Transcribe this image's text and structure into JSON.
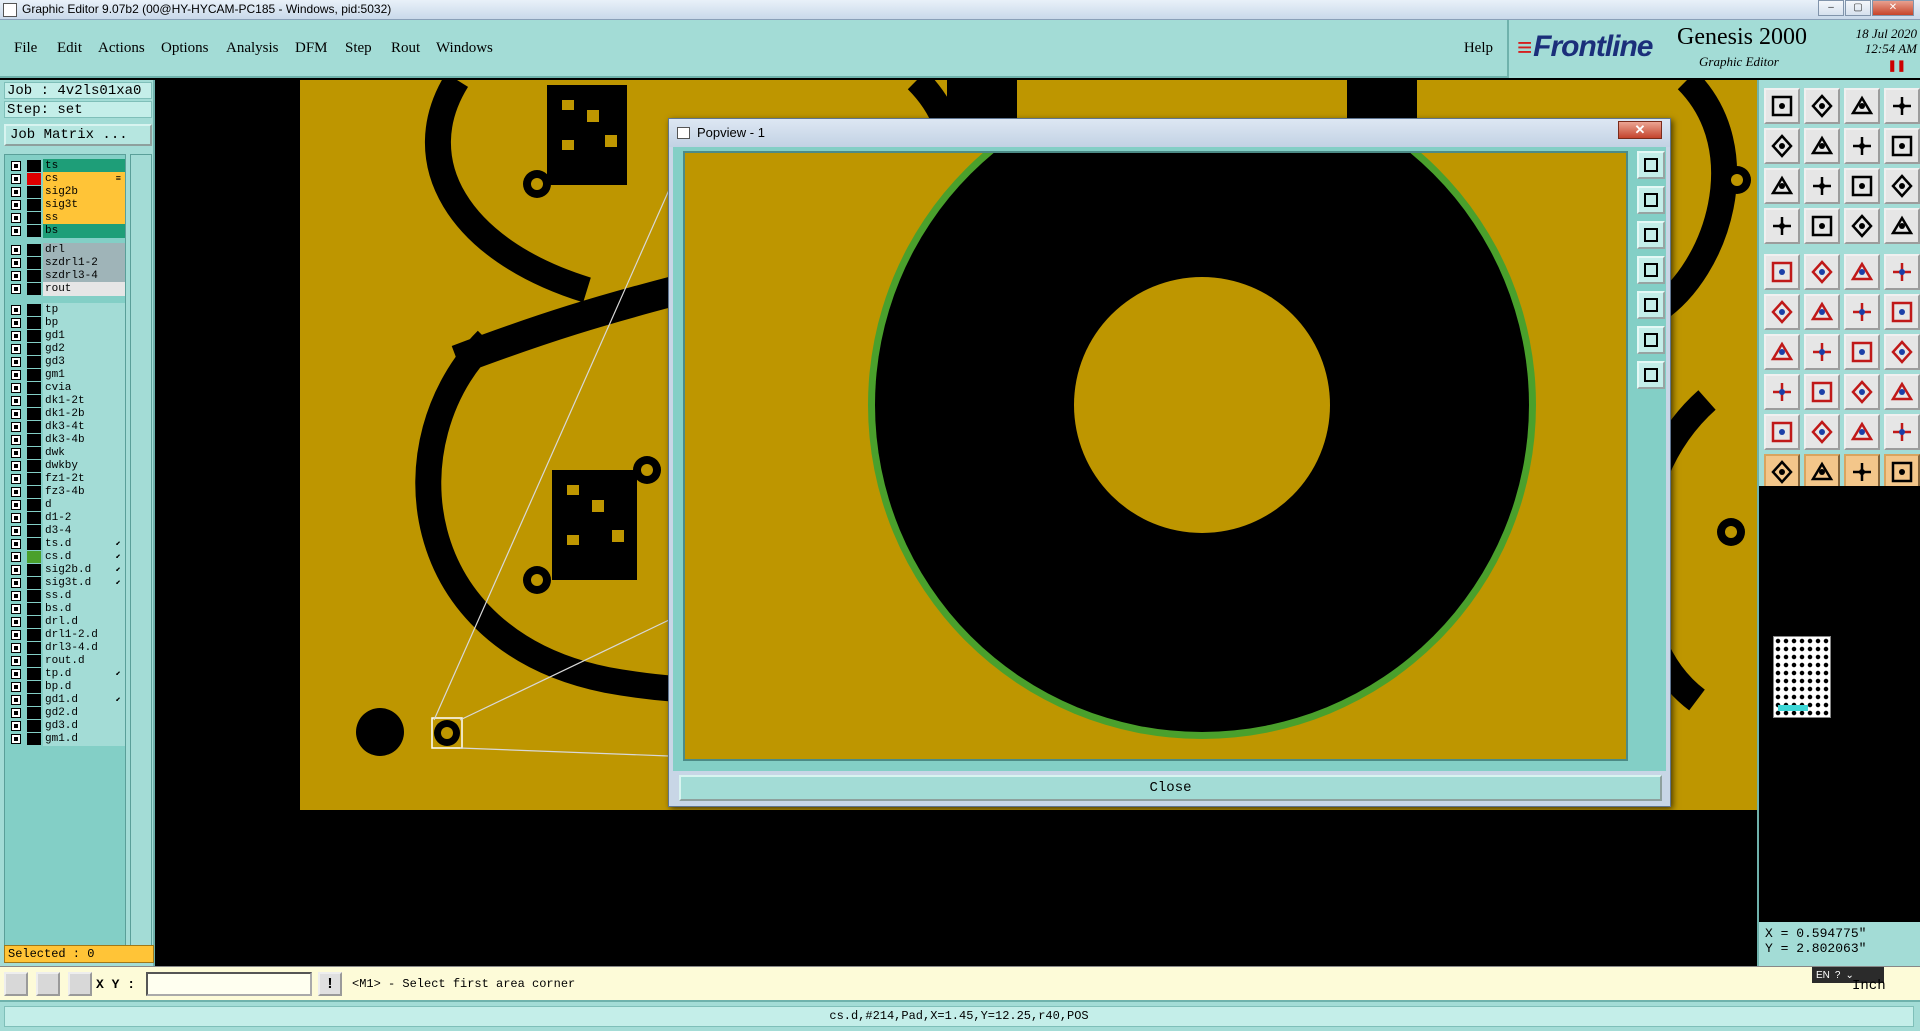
{
  "window": {
    "title": "Graphic Editor 9.07b2 (00@HY-HYCAM-PC185 - Windows, pid:5032)",
    "min": "–",
    "max": "▢",
    "close": "✕"
  },
  "menu": {
    "items": [
      "File",
      "Edit",
      "Actions",
      "Options",
      "Analysis",
      "DFM",
      "Step",
      "Rout",
      "Windows"
    ],
    "help": "Help"
  },
  "brand": {
    "logo": "Frontline",
    "product": "Genesis 2000",
    "subtitle": "Graphic Editor",
    "date": "18 Jul 2020",
    "time": "12:54 AM",
    "pause": "❚❚"
  },
  "left": {
    "job": "Job : 4v2ls01xa0",
    "step": "Step: set",
    "job_matrix": "Job Matrix ...",
    "selected": "Selected : 0"
  },
  "layers": [
    {
      "name": "ts",
      "bg": "#1e9e78",
      "sw": "#000000",
      "mk": ""
    },
    {
      "name": "cs",
      "bg": "#ffc437",
      "sw": "#e00000",
      "mk": "≡"
    },
    {
      "name": "sig2b",
      "bg": "#ffc437",
      "sw": "#000000",
      "mk": ""
    },
    {
      "name": "sig3t",
      "bg": "#ffc437",
      "sw": "#000000",
      "mk": ""
    },
    {
      "name": "ss",
      "bg": "#ffc437",
      "sw": "#000000",
      "mk": ""
    },
    {
      "name": "bs",
      "bg": "#1e9e78",
      "sw": "#000000",
      "mk": ""
    },
    {
      "name": "drl",
      "bg": "#9fb4b8",
      "sw": "#000000",
      "mk": ""
    },
    {
      "name": "szdrl1-2",
      "bg": "#9fb4b8",
      "sw": "#000000",
      "mk": ""
    },
    {
      "name": "szdrl3-4",
      "bg": "#9fb4b8",
      "sw": "#000000",
      "mk": ""
    },
    {
      "name": "rout",
      "bg": "#e6e6e6",
      "sw": "#000000",
      "mk": ""
    },
    {
      "name": "tp",
      "bg": "#a3dcd6",
      "sw": "#000000",
      "mk": ""
    },
    {
      "name": "bp",
      "bg": "#a3dcd6",
      "sw": "#000000",
      "mk": ""
    },
    {
      "name": "gd1",
      "bg": "#a3dcd6",
      "sw": "#000000",
      "mk": ""
    },
    {
      "name": "gd2",
      "bg": "#a3dcd6",
      "sw": "#000000",
      "mk": ""
    },
    {
      "name": "gd3",
      "bg": "#a3dcd6",
      "sw": "#000000",
      "mk": ""
    },
    {
      "name": "gm1",
      "bg": "#a3dcd6",
      "sw": "#000000",
      "mk": ""
    },
    {
      "name": "cvia",
      "bg": "#a3dcd6",
      "sw": "#000000",
      "mk": ""
    },
    {
      "name": "dk1-2t",
      "bg": "#a3dcd6",
      "sw": "#000000",
      "mk": ""
    },
    {
      "name": "dk1-2b",
      "bg": "#a3dcd6",
      "sw": "#000000",
      "mk": ""
    },
    {
      "name": "dk3-4t",
      "bg": "#a3dcd6",
      "sw": "#000000",
      "mk": ""
    },
    {
      "name": "dk3-4b",
      "bg": "#a3dcd6",
      "sw": "#000000",
      "mk": ""
    },
    {
      "name": "dwk",
      "bg": "#a3dcd6",
      "sw": "#000000",
      "mk": ""
    },
    {
      "name": "dwkby",
      "bg": "#a3dcd6",
      "sw": "#000000",
      "mk": ""
    },
    {
      "name": "fz1-2t",
      "bg": "#a3dcd6",
      "sw": "#000000",
      "mk": ""
    },
    {
      "name": "fz3-4b",
      "bg": "#a3dcd6",
      "sw": "#000000",
      "mk": ""
    },
    {
      "name": "d",
      "bg": "#a3dcd6",
      "sw": "#000000",
      "mk": ""
    },
    {
      "name": "d1-2",
      "bg": "#a3dcd6",
      "sw": "#000000",
      "mk": ""
    },
    {
      "name": "d3-4",
      "bg": "#a3dcd6",
      "sw": "#000000",
      "mk": ""
    },
    {
      "name": "ts.d",
      "bg": "#a3dcd6",
      "sw": "#000000",
      "mk": "⬋"
    },
    {
      "name": "cs.d",
      "bg": "#a3dcd6",
      "sw": "#4aa02c",
      "mk": "⬋"
    },
    {
      "name": "sig2b.d",
      "bg": "#a3dcd6",
      "sw": "#000000",
      "mk": "⬋"
    },
    {
      "name": "sig3t.d",
      "bg": "#a3dcd6",
      "sw": "#000000",
      "mk": "⬋"
    },
    {
      "name": "ss.d",
      "bg": "#a3dcd6",
      "sw": "#000000",
      "mk": ""
    },
    {
      "name": "bs.d",
      "bg": "#a3dcd6",
      "sw": "#000000",
      "mk": ""
    },
    {
      "name": "drl.d",
      "bg": "#a3dcd6",
      "sw": "#000000",
      "mk": ""
    },
    {
      "name": "drl1-2.d",
      "bg": "#a3dcd6",
      "sw": "#000000",
      "mk": ""
    },
    {
      "name": "drl3-4.d",
      "bg": "#a3dcd6",
      "sw": "#000000",
      "mk": ""
    },
    {
      "name": "rout.d",
      "bg": "#a3dcd6",
      "sw": "#000000",
      "mk": ""
    },
    {
      "name": "tp.d",
      "bg": "#a3dcd6",
      "sw": "#000000",
      "mk": "⬋"
    },
    {
      "name": "bp.d",
      "bg": "#a3dcd6",
      "sw": "#000000",
      "mk": ""
    },
    {
      "name": "gd1.d",
      "bg": "#a3dcd6",
      "sw": "#000000",
      "mk": "⬋"
    },
    {
      "name": "gd2.d",
      "bg": "#a3dcd6",
      "sw": "#000000",
      "mk": ""
    },
    {
      "name": "gd3.d",
      "bg": "#a3dcd6",
      "sw": "#000000",
      "mk": ""
    },
    {
      "name": "gm1.d",
      "bg": "#a3dcd6",
      "sw": "#000000",
      "mk": ""
    }
  ],
  "popup": {
    "title": "Popview - 1",
    "close_x": "✕",
    "close_button": "Close"
  },
  "coords": {
    "x": "X = 0.594775\"",
    "y": "Y = 2.802063\""
  },
  "bottom": {
    "xy_label": "X Y :",
    "xy_value": "",
    "warn": "!",
    "prompt": "<M1> - Select first area corner",
    "ime": [
      "EN",
      "?",
      "⌄"
    ],
    "unit": "Inch"
  },
  "status": "cs.d,#214,Pad,X=1.45,Y=12.25,r40,POS",
  "colors": {
    "copper": "#be9600",
    "panel": "#a3dcd6",
    "highlight_layer": "#ffc437",
    "pad_ring": "#4aa02c"
  }
}
